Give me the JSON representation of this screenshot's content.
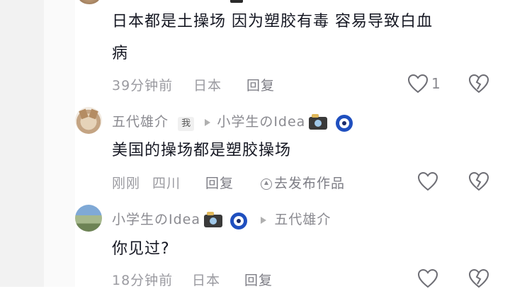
{
  "comment1": {
    "text_line1": "日本都是土操场  因为塑胶有毒  容易导致白血",
    "text_line2": "病",
    "time": "39分钟前",
    "location": "日本",
    "reply_label": "回复",
    "like_count": "1"
  },
  "comment2": {
    "author": "五代雄介",
    "me_badge": "我",
    "reply_to": "小学生のIdea",
    "text": "美国的操场都是塑胶操场",
    "time": "刚刚",
    "location": "四川",
    "reply_label": "回复",
    "publish_label": "去发布作品"
  },
  "comment3": {
    "author": "小学生のIdea",
    "reply_to": "五代雄介",
    "text": "你见过?",
    "time": "18分钟前",
    "location": "日本",
    "reply_label": "回复"
  },
  "icons": {
    "like": "heart-outline-icon",
    "dislike": "broken-heart-icon",
    "camera": "camera-emoji-icon",
    "nazar": "nazar-amulet-icon",
    "arrow": "reply-arrow-icon"
  },
  "colors": {
    "text": "#161823",
    "meta": "#9a9aa0",
    "background": "#ffffff"
  }
}
